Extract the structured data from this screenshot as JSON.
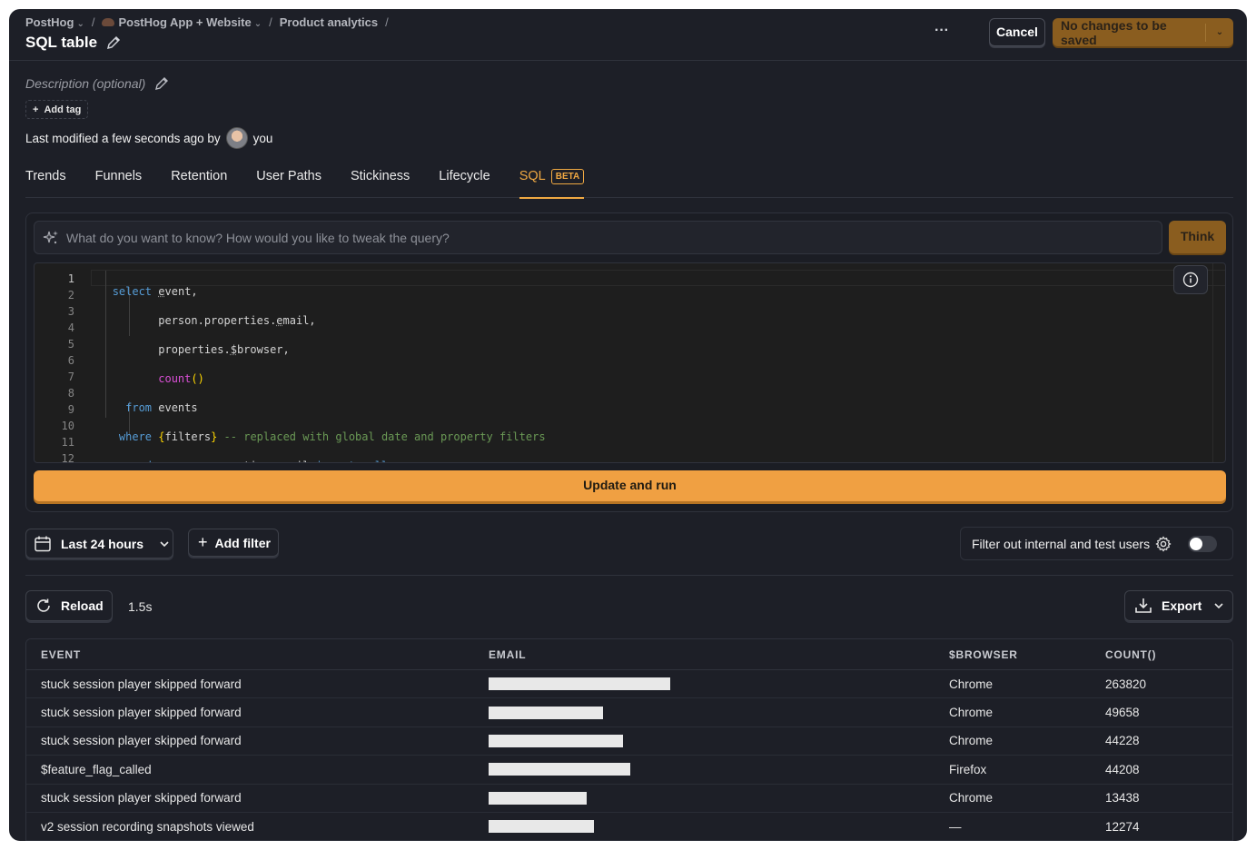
{
  "breadcrumbs": [
    {
      "label": "PostHog",
      "dropdown": true
    },
    {
      "label": "PostHog App + Website",
      "dropdown": true
    },
    {
      "label": "Product analytics",
      "dropdown": false
    }
  ],
  "page": {
    "title": "SQL table",
    "description_placeholder": "Description (optional)",
    "add_tag_label": "Add tag",
    "modified_text": "Last modified a few seconds ago by",
    "modified_by": "you"
  },
  "header": {
    "more_label": "···",
    "cancel_label": "Cancel",
    "save_label": "No changes to be saved"
  },
  "tabs": [
    {
      "label": "Trends",
      "active": false
    },
    {
      "label": "Funnels",
      "active": false
    },
    {
      "label": "Retention",
      "active": false
    },
    {
      "label": "User Paths",
      "active": false
    },
    {
      "label": "Stickiness",
      "active": false
    },
    {
      "label": "Lifecycle",
      "active": false
    },
    {
      "label": "SQL",
      "active": true,
      "badge": "BETA"
    }
  ],
  "query": {
    "ask_placeholder": "What do you want to know? How would you like to tweak the query?",
    "think_label": "Think",
    "run_label": "Update and run",
    "line_numbers": [
      "1",
      "2",
      "3",
      "4",
      "5",
      "6",
      "7",
      "8",
      "9",
      "10",
      "11",
      "12"
    ]
  },
  "filters": {
    "date_label": "Last 24 hours",
    "add_filter_label": "Add filter",
    "internal_label": "Filter out internal and test users",
    "internal_enabled": false
  },
  "results": {
    "reload_label": "Reload",
    "timing": "1.5s",
    "export_label": "Export",
    "columns": [
      "EVENT",
      "EMAIL",
      "$BROWSER",
      "COUNT()"
    ],
    "rows": [
      {
        "event": "stuck session player skipped forward",
        "email_redacted": true,
        "browser": "Chrome",
        "count": "263820"
      },
      {
        "event": "stuck session player skipped forward",
        "email_redacted": true,
        "browser": "Chrome",
        "count": "49658"
      },
      {
        "event": "stuck session player skipped forward",
        "email_redacted": true,
        "browser": "Chrome",
        "count": "44228"
      },
      {
        "event": "$feature_flag_called",
        "email_redacted": true,
        "browser": "Firefox",
        "count": "44208"
      },
      {
        "event": "stuck session player skipped forward",
        "email_redacted": true,
        "browser": "Chrome",
        "count": "13438"
      },
      {
        "event": "v2 session recording snapshots viewed",
        "email_redacted": true,
        "browser": "—",
        "count": "12274"
      }
    ]
  },
  "colors": {
    "background": "#1d1f27",
    "accent": "#f0a042",
    "accent_muted": "#8a5d1f"
  }
}
